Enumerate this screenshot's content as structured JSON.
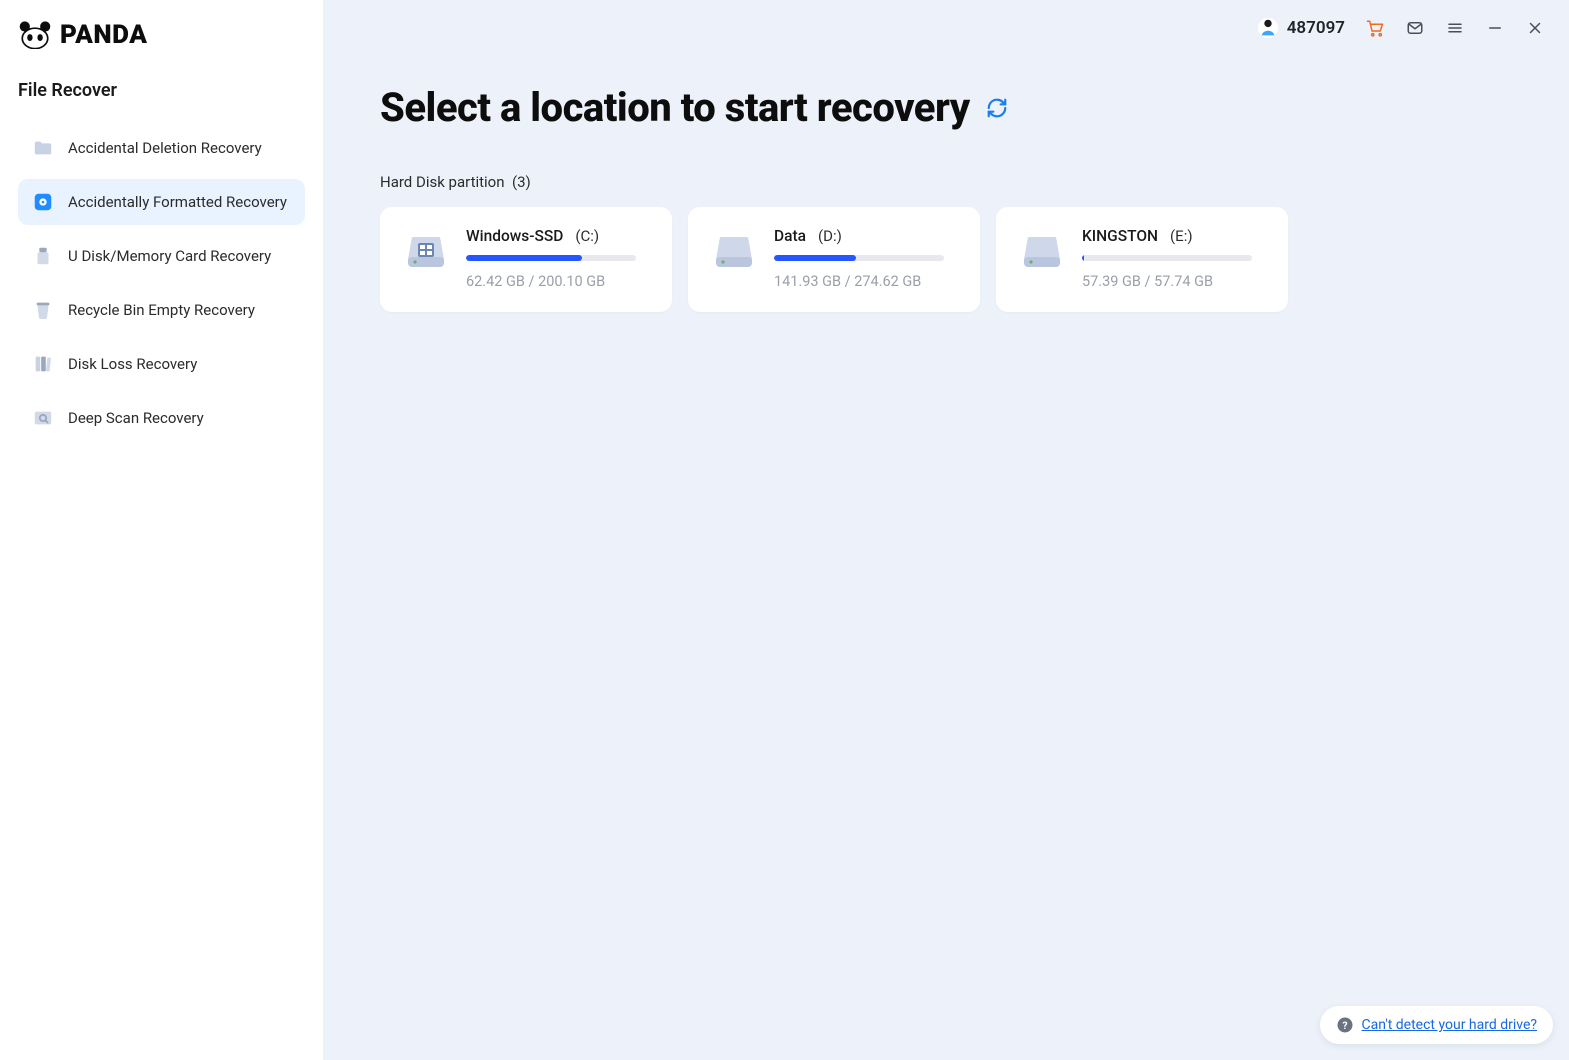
{
  "brand": "PANDA",
  "sidebar": {
    "title": "File Recover",
    "items": [
      {
        "label": "Accidental Deletion Recovery",
        "icon": "folder-icon",
        "active": false
      },
      {
        "label": "Accidentally Formatted Recovery",
        "icon": "disk-blue-icon",
        "active": true
      },
      {
        "label": "U Disk/Memory Card Recovery",
        "icon": "usb-icon",
        "active": false
      },
      {
        "label": "Recycle Bin Empty Recovery",
        "icon": "trash-icon",
        "active": false
      },
      {
        "label": "Disk Loss Recovery",
        "icon": "books-icon",
        "active": false
      },
      {
        "label": "Deep Scan Recovery",
        "icon": "scan-icon",
        "active": false
      }
    ]
  },
  "topbar": {
    "user_id": "487097"
  },
  "page": {
    "title": "Select a location to start recovery",
    "section_label": "Hard Disk partition",
    "section_count": "(3)"
  },
  "drives": [
    {
      "name": "Windows-SSD",
      "letter": "(C:)",
      "used": "62.42 GB",
      "total": "200.10 GB",
      "percent": 68
    },
    {
      "name": "Data",
      "letter": "(D:)",
      "used": "141.93 GB",
      "total": "274.62 GB",
      "percent": 48
    },
    {
      "name": "KINGSTON",
      "letter": "(E:)",
      "used": "57.39 GB",
      "total": "57.74 GB",
      "percent": 1
    }
  ],
  "help": {
    "link_text": "Can't detect your hard drive?"
  }
}
